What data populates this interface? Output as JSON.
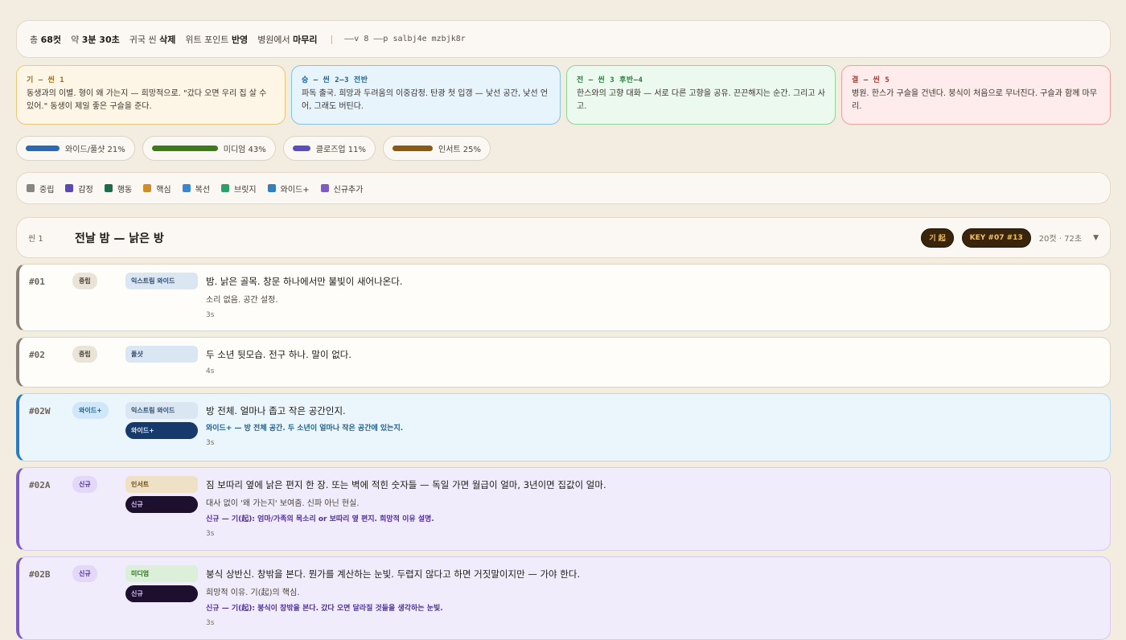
{
  "summary": {
    "total_prefix": "총",
    "total": "68컷",
    "runtime_prefix": "약",
    "runtime": "3분 30초",
    "return_prefix": "귀국 씬",
    "return_val": "삭제",
    "wit_prefix": "위트 포인트",
    "wit_val": "반영",
    "hospital_prefix": "병원에서",
    "hospital_val": "마무리",
    "command": "——v 8 ——p salbj4e mzbjk8r"
  },
  "acts": [
    {
      "title": "기 — 씬 1",
      "desc": "동생과의 이별. 형이 왜 가는지 — 희망적으로. \"갔다 오면 우리 집 살 수 있어.\" 동생이 제일 좋은 구슬을 준다.",
      "color": "#e9c77b"
    },
    {
      "title": "승 — 씬 2–3 전반",
      "desc": "파독 출국. 희망과 두려움의 이중감정. 탄광 첫 입갱 — 낯선 공간, 낯선 언어, 그래도 버틴다.",
      "color": "#86c1e6"
    },
    {
      "title": "전 — 씬 3 후반–4",
      "desc": "한스와의 고향 대화 — 서로 다른 고향을 공유. 끈끈해지는 순간. 그리고 사고.",
      "color": "#8fd49b"
    },
    {
      "title": "결 — 씬 5",
      "desc": "병원. 한스가 구슬을 건넨다. 붕식이 처음으로 무너진다. 구슬과 함께 마무리.",
      "color": "#eea49c"
    }
  ],
  "shot_distribution": [
    {
      "label": "와이드/풀샷 21%",
      "percent": 21,
      "color": "#2a68b3"
    },
    {
      "label": "미디엄 43%",
      "percent": 43,
      "color": "#3f7a1a"
    },
    {
      "label": "클로즈업 11%",
      "percent": 11,
      "color": "#5a4cc2"
    },
    {
      "label": "인서트 25%",
      "percent": 25,
      "color": "#8a5a12"
    }
  ],
  "legend": [
    {
      "label": "중립",
      "color": "#8a8580"
    },
    {
      "label": "감정",
      "color": "#5b49b8"
    },
    {
      "label": "행동",
      "color": "#1f6b4a"
    },
    {
      "label": "핵심",
      "color": "#d08d27"
    },
    {
      "label": "복선",
      "color": "#3a86d4"
    },
    {
      "label": "브릿지",
      "color": "#2aa06a"
    },
    {
      "label": "와이드+",
      "color": "#2f7fc4"
    },
    {
      "label": "신규추가",
      "color": "#7b5cc9"
    }
  ],
  "scene": {
    "number": "씬 1",
    "title": "전날 밤 — 낡은 방",
    "act_badge": "기 起",
    "key_badge": "KEY #07 #13",
    "count": "20컷 · 72초"
  },
  "cuts": [
    {
      "id": "#01",
      "tag": "중립",
      "shots": [
        "익스트림 와이드"
      ],
      "main": "밤. 낡은 골목. 창문 하나에서만 불빛이 새어나온다.",
      "sub": "소리 없음. 공간 설정.",
      "note": "",
      "dur": "3s"
    },
    {
      "id": "#02",
      "tag": "중립",
      "shots": [
        "풀샷"
      ],
      "main": "두 소년 뒷모습. 전구 하나. 말이 없다.",
      "sub": "",
      "note": "",
      "dur": "4s"
    },
    {
      "id": "#02W",
      "tag": "와이드+",
      "shots": [
        "익스트림 와이드",
        "와이드+"
      ],
      "main": "방 전체. 얼마나 좁고 작은 공간인지.",
      "sub": "",
      "note": "와이드+ — 방 전체 공간. 두 소년이 얼마나 작은 공간에 있는지.",
      "dur": "3s"
    },
    {
      "id": "#02A",
      "tag": "신규",
      "shots": [
        "인서트",
        "신규"
      ],
      "main": "짐 보따리 옆에 낡은 편지 한 장. 또는 벽에 적힌 숫자들 — 독일 가면 월급이 얼마, 3년이면 집값이 얼마.",
      "sub": "대사 없이 '왜 가는지' 보여줌. 신파 아닌 현실.",
      "note": "신규 — 기(起): 엄마/가족의 목소리 or 보따리 옆 편지. 희망적 이유 설명.",
      "dur": "3s"
    },
    {
      "id": "#02B",
      "tag": "신규",
      "shots": [
        "미디엄",
        "신규"
      ],
      "main": "붕식 상반신. 창밖을 본다. 뭔가를 계산하는 눈빛. 두렵지 않다고 하면 거짓말이지만 — 가야 한다.",
      "sub": "희망적 이유. 기(起)의 핵심.",
      "note": "신규 — 기(起): 붕식이 창밖을 본다. 갔다 오면 달라질 것들을 생각하는 눈빛.",
      "dur": "3s"
    }
  ]
}
